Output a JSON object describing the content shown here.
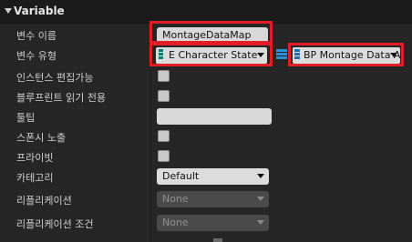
{
  "section": {
    "title": "Variable"
  },
  "rows": {
    "name": {
      "label": "변수 이름",
      "value": "MontageDataMap"
    },
    "type": {
      "label": "변수 유형",
      "key_type": "E Character State",
      "value_type": "BP Montage Data A"
    },
    "instance_editable": {
      "label": "인스턴스 편집가능"
    },
    "blueprint_readonly": {
      "label": "블루프린트 읽기 전용"
    },
    "tooltip": {
      "label": "툴팁",
      "value": ""
    },
    "expose_spawn": {
      "label": "스폰시 노출"
    },
    "private": {
      "label": "프라이빗"
    },
    "category": {
      "label": "카테고리",
      "value": "Default"
    },
    "replication": {
      "label": "리플리케이션",
      "value": "None"
    },
    "replication_condition": {
      "label": "리플리케이션 조건",
      "value": "None"
    }
  },
  "colors": {
    "highlight": "#e21d25",
    "enum": "#0b7a6f",
    "map": "#2b8fd6",
    "struct": "#1e6fb8"
  }
}
